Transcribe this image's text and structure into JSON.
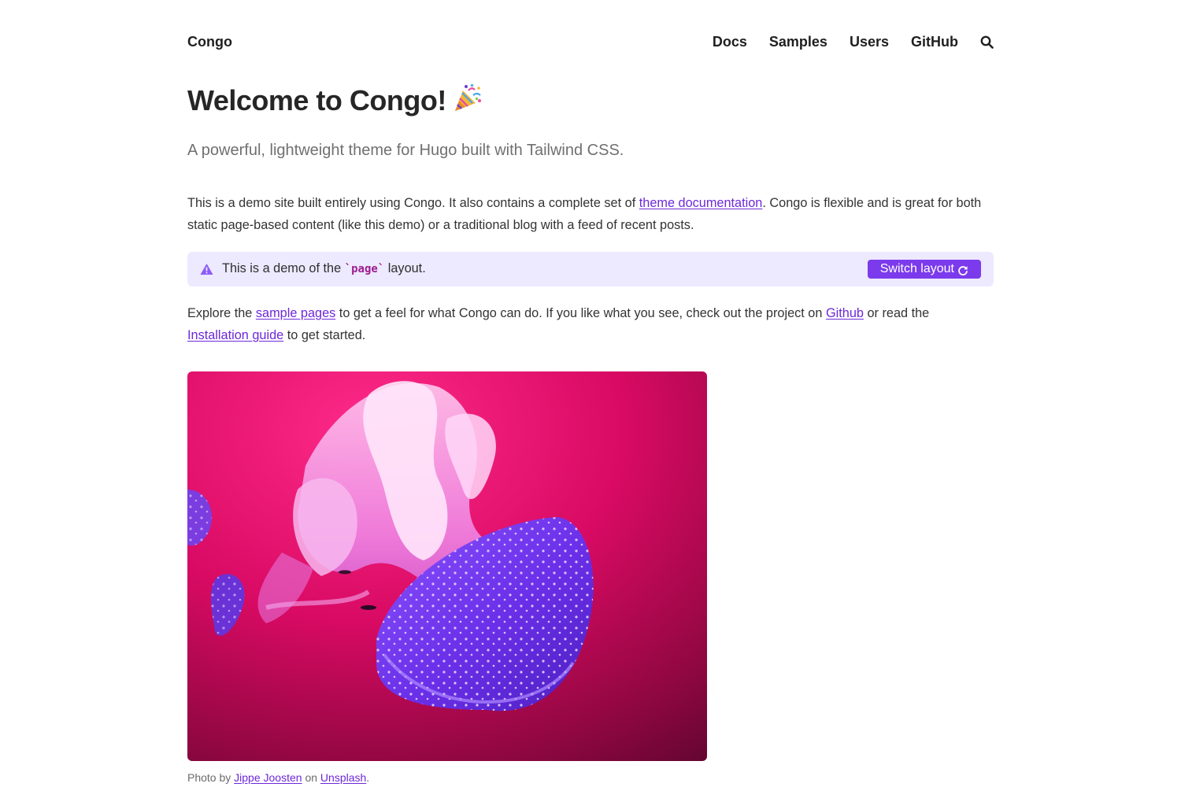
{
  "header": {
    "site_title": "Congo",
    "nav": [
      "Docs",
      "Samples",
      "Users",
      "GitHub"
    ],
    "search_icon": "search-icon"
  },
  "main": {
    "title": "Welcome to Congo!",
    "title_icon": "party-popper-icon",
    "lead": "A powerful, lightweight theme for Hugo built with Tailwind CSS.",
    "intro": {
      "before": "This is a demo site built entirely using Congo. It also contains a complete set of ",
      "link": "theme documentation",
      "after": ". Congo is flexible and is great for both static page-based content (like this demo) or a traditional blog with a feed of recent posts."
    },
    "alert": {
      "icon": "warning-triangle-icon",
      "before": "This is a demo of the ",
      "code": "`page`",
      "after": " layout.",
      "button": "Switch layout",
      "button_icon": "refresh-icon"
    },
    "explore": {
      "t1": "Explore the ",
      "link1": "sample pages",
      "t2": " to get a feel for what Congo can do. If you like what you see, check out the project on ",
      "link2": "Github",
      "t3": " or read the ",
      "link3": "Installation guide",
      "t4": " to get started."
    },
    "caption": {
      "t1": "Photo by ",
      "author": "Jippe Joosten",
      "t2": " on ",
      "site": "Unsplash",
      "t3": "."
    }
  },
  "colors": {
    "accent": "#7c3aed",
    "link": "#6d28d9",
    "alert_bg": "#ede9fe"
  }
}
